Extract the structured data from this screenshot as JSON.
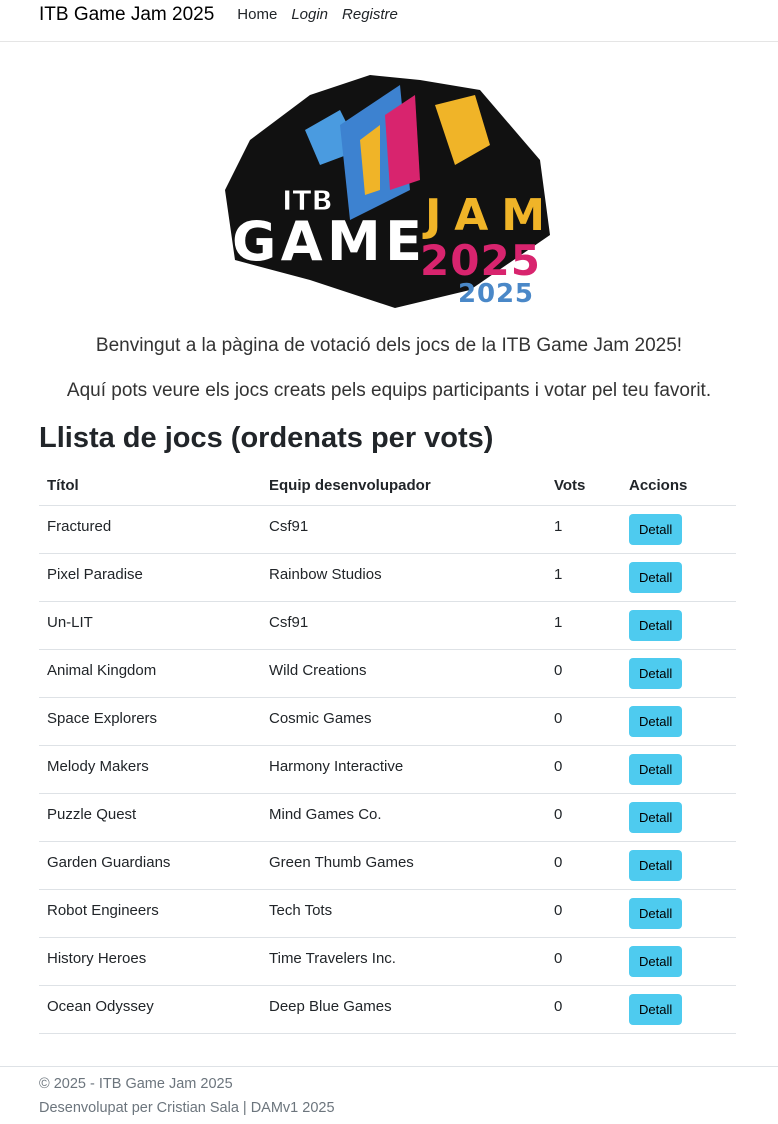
{
  "navbar": {
    "brand": "ITB Game Jam 2025",
    "links": [
      "Home",
      "Login",
      "Registre"
    ]
  },
  "logo": {
    "line1": "ITB",
    "line2": "GAME",
    "line3": "JAM",
    "line4": "2025",
    "line5": "2025"
  },
  "intro": {
    "line1": "Benvingut a la pàgina de votació dels jocs de la ITB Game Jam 2025!",
    "line2": "Aquí pots veure els jocs creats pels equips participants i votar pel teu favorit."
  },
  "list": {
    "title": "Llista de jocs (ordenats per vots)",
    "headers": [
      "Títol",
      "Equip desenvolupador",
      "Vots",
      "Accions"
    ],
    "button_label": "Detall",
    "rows": [
      [
        "Fractured",
        "Csf91",
        "1"
      ],
      [
        "Pixel Paradise",
        "Rainbow Studios",
        "1"
      ],
      [
        "Un-LIT",
        "Csf91",
        "1"
      ],
      [
        "Animal Kingdom",
        "Wild Creations",
        "0"
      ],
      [
        "Space Explorers",
        "Cosmic Games",
        "0"
      ],
      [
        "Melody Makers",
        "Harmony Interactive",
        "0"
      ],
      [
        "Puzzle Quest",
        "Mind Games Co.",
        "0"
      ],
      [
        "Garden Guardians",
        "Green Thumb Games",
        "0"
      ],
      [
        "Robot Engineers",
        "Tech Tots",
        "0"
      ],
      [
        "History Heroes",
        "Time Travelers Inc.",
        "0"
      ],
      [
        "Ocean Odyssey",
        "Deep Blue Games",
        "0"
      ]
    ]
  },
  "footer": {
    "line1": "© 2025 - ITB Game Jam 2025",
    "line2": "Desenvolupat per Cristian Sala | DAMv1 2025"
  },
  "colors": {
    "button": "#4ecbef"
  }
}
